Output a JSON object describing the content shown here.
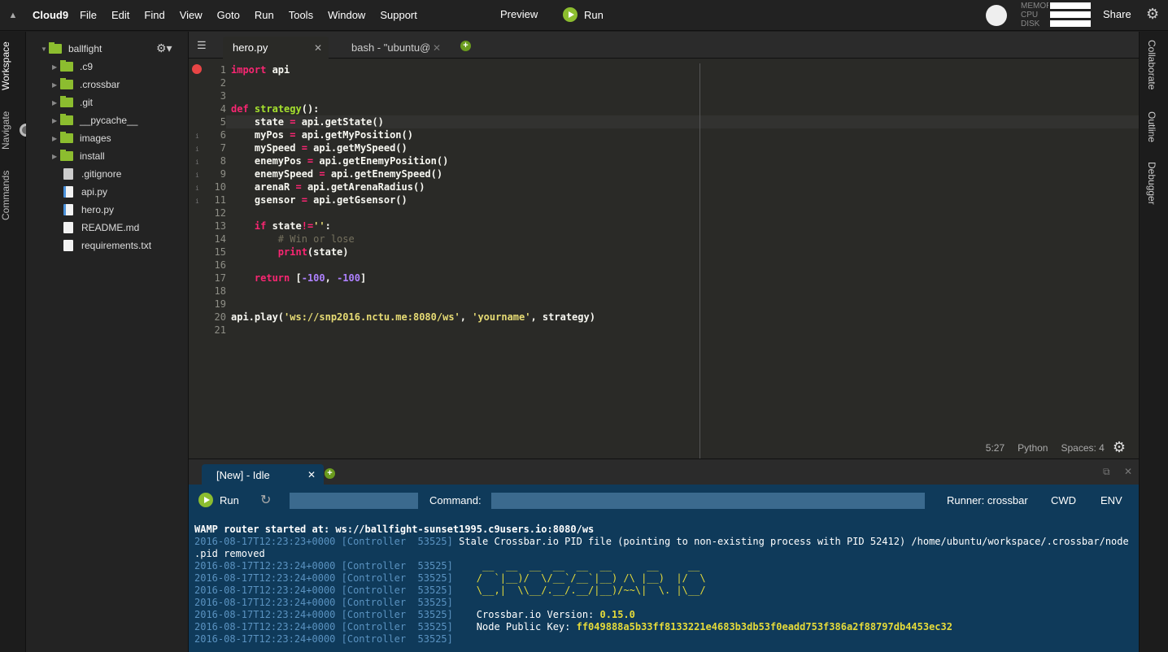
{
  "menubar": {
    "brand": "Cloud9",
    "items": [
      "File",
      "Edit",
      "Find",
      "View",
      "Goto",
      "Run",
      "Tools",
      "Window",
      "Support"
    ],
    "preview": "Preview",
    "run": "Run",
    "metrics": [
      "MEMORY",
      "CPU",
      "DISK"
    ],
    "share": "Share"
  },
  "left_tabs": [
    "Workspace",
    "Navigate",
    "Commands"
  ],
  "tree": {
    "root": "ballfight",
    "folders": [
      ".c9",
      ".crossbar",
      ".git",
      "__pycache__",
      "images",
      "install"
    ],
    "files": [
      ".gitignore",
      "api.py",
      "hero.py",
      "README.md",
      "requirements.txt"
    ]
  },
  "editor_tabs": [
    {
      "label": "hero.py",
      "active": true
    },
    {
      "label": "bash - \"ubuntu@",
      "active": false
    }
  ],
  "editor": {
    "line_numbers": [
      "1",
      "2",
      "3",
      "4",
      "5",
      "6",
      "7",
      "8",
      "9",
      "10",
      "11",
      "12",
      "13",
      "14",
      "15",
      "16",
      "17",
      "18",
      "19",
      "20",
      "21"
    ],
    "status": {
      "position": "5:27",
      "language": "Python",
      "indent": "Spaces: 4"
    }
  },
  "bottom": {
    "tab_label": "[New] - Idle",
    "run": "Run",
    "command_label": "Command:",
    "runner": "Runner: crossbar",
    "cwd": "CWD",
    "env": "ENV"
  },
  "console": {
    "header": "WAMP router started at: ws://ballfight-sunset1995.c9users.io:8080/ws",
    "timestamp": "2016-08-17T12:23:23+0000 [Controller  53525]",
    "timestamp2": "2016-08-17T12:23:24+0000 [Controller  53525]",
    "stale_msg": " Stale Crossbar.io PID file (pointing to non-existing process with PID 52412) /home/ubuntu/workspace/.crossbar/node",
    "stale_msg2": ".pid removed",
    "ascii1": "     __  __  __  __  __  __      __     __",
    "ascii2": "    /  `|__)/  \\/__`/__`|__) /\\ |__)  |/  \\",
    "ascii3": "    \\__,|  \\\\__/.__/.__/|__)/~~\\|  \\. |\\__/",
    "version_label": "    Crossbar.io Version: ",
    "version": "0.15.0",
    "key_label": "    Node Public Key: ",
    "key": "ff049888a5b33ff8133221e4683b3db53f0eadd753f386a2f88797db4453ec32"
  },
  "right_tabs": [
    "Collaborate",
    "Outline",
    "Debugger"
  ]
}
